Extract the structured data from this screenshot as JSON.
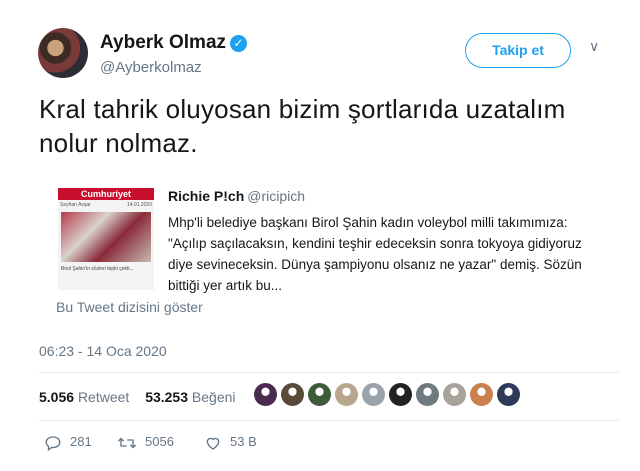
{
  "author": {
    "name": "Ayberk Olmaz",
    "handle": "@Ayberkolmaz",
    "verified_glyph": "✓",
    "avatar_icon": "profile-photo"
  },
  "follow_label": "Takip et",
  "menu_glyph": "∨",
  "tweet_text": "Kral tahrik oluyosan bizim şortlarıda uzatalım nolur nolmaz.",
  "quote": {
    "name": "Richie P!ch",
    "handle": "@ricipich",
    "text": "Mhp'li belediye başkanı Birol Şahin kadın voleybol milli takımımıza: \"Açılıp saçılacaksın, kendini teşhir edeceksin sonra tokyoya gidiyoruz diye sevineceksin. Dünya şampiyonu olsanız ne yazar\" demiş. Sözün bittiği yer artık bu...",
    "thread_link": "Bu Tweet dizisini göster",
    "thumb": {
      "masthead": "Cumhuriyet",
      "byline": "Seyhan Avşar",
      "date": "14.01.2020",
      "caption": "Birol Şahin'in sözleri tepki çekti..."
    }
  },
  "timestamp": "06:23 - 14 Oca 2020",
  "stats": {
    "retweets_count": "5.056",
    "retweets_label": "Retweet",
    "likes_count": "53.253",
    "likes_label": "Beğeni"
  },
  "likers": [
    "#4b2a4f",
    "#5a4a3a",
    "#3f5a3a",
    "#b7a58c",
    "#9aa3ab",
    "#222222",
    "#6f7a80",
    "#a8a39a",
    "#c97f4f",
    "#2f3a5a"
  ],
  "actions": {
    "replies": "281",
    "retweets": "5056",
    "likes": "53 B"
  },
  "colors": {
    "accent": "#1da1f2",
    "muted": "#657786",
    "text": "#14171a"
  }
}
